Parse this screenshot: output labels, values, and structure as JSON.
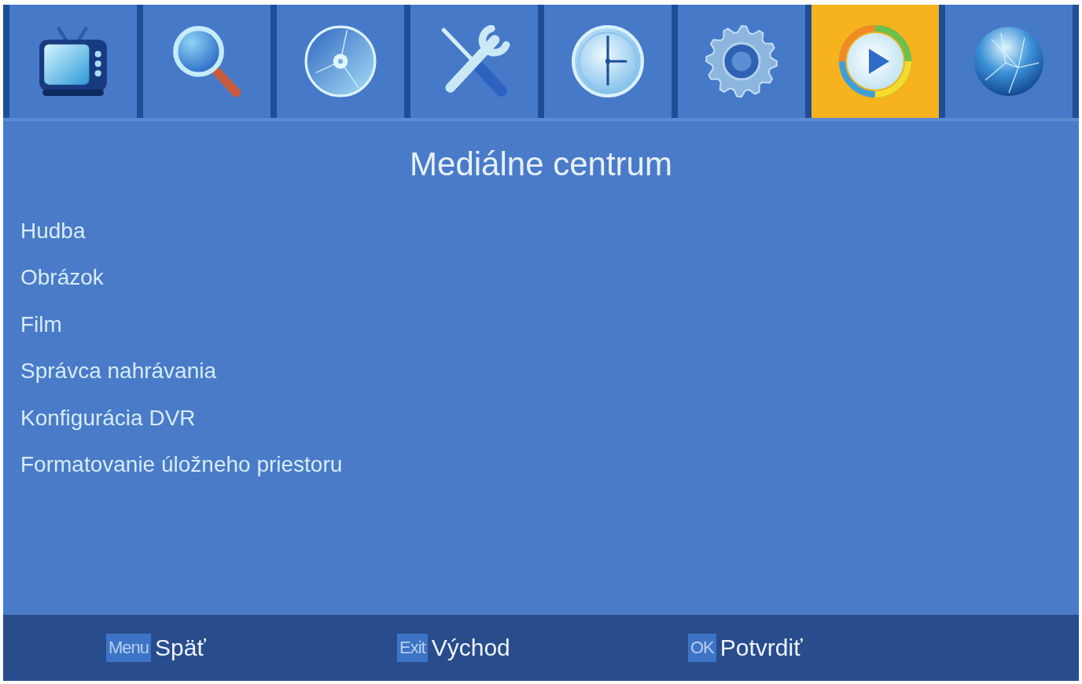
{
  "tabs": [
    {
      "selected": false
    },
    {
      "selected": false
    },
    {
      "selected": false
    },
    {
      "selected": false
    },
    {
      "selected": false
    },
    {
      "selected": false
    },
    {
      "selected": true
    },
    {
      "selected": false
    }
  ],
  "title": "Mediálne centrum",
  "menu": {
    "items": [
      "Hudba",
      "Obrázok",
      "Film",
      "Správca nahrávania",
      "Konfigurácia DVR",
      "Formatovanie úložneho priestoru"
    ]
  },
  "footer": {
    "hints": [
      {
        "key": "Menu",
        "label": "Späť"
      },
      {
        "key": "Exit",
        "label": "Východ"
      },
      {
        "key": "OK",
        "label": "Potvrdiť"
      }
    ]
  }
}
